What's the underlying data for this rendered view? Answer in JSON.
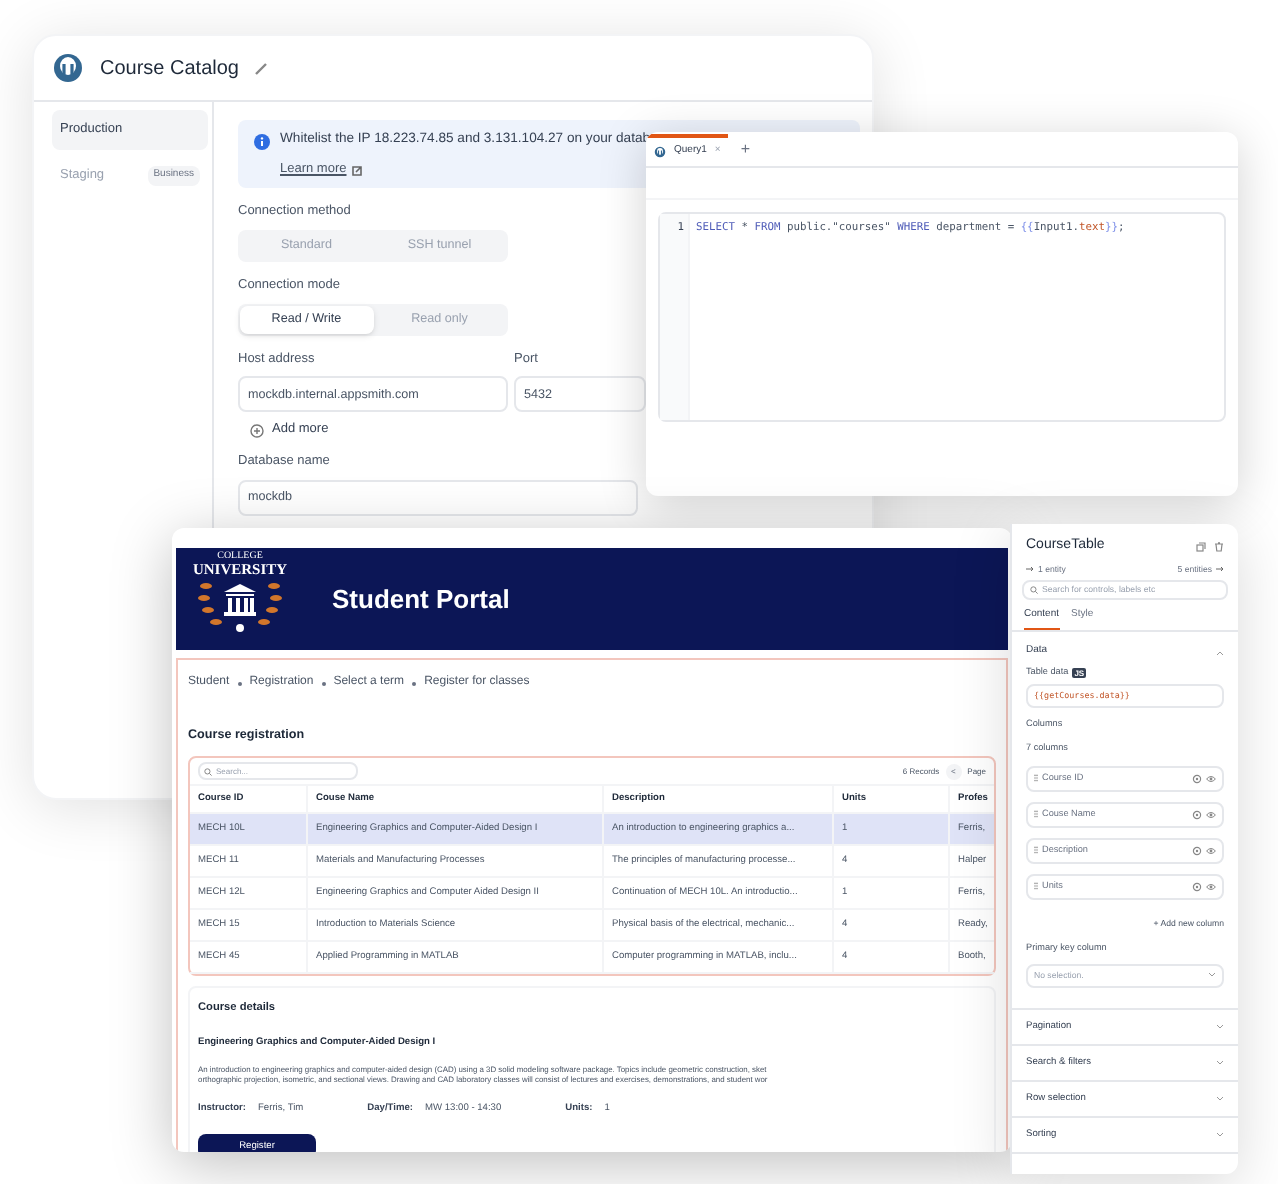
{
  "datasource": {
    "title": "Course Catalog",
    "environments": [
      {
        "label": "Production",
        "selected": true
      },
      {
        "label": "Staging",
        "selected": false,
        "badge": "Business"
      }
    ],
    "banner": {
      "text": "Whitelist the IP 18.223.74.85 and 3.131.104.27 on your datab",
      "link": "Learn more"
    },
    "connection_method": {
      "label": "Connection method",
      "options": [
        {
          "label": "Standard",
          "selected": false
        },
        {
          "label": "SSH tunnel",
          "selected": false
        }
      ]
    },
    "connection_mode": {
      "label": "Connection mode",
      "options": [
        {
          "label": "Read / Write",
          "selected": true
        },
        {
          "label": "Read only",
          "selected": false
        }
      ]
    },
    "host": {
      "label": "Host address",
      "value": "mockdb.internal.appsmith.com"
    },
    "port": {
      "label": "Port",
      "value": "5432"
    },
    "add_more": "Add more",
    "database": {
      "label": "Database name",
      "value": "mockdb"
    }
  },
  "query": {
    "tabs": [
      {
        "label": "Query1",
        "selected": true,
        "close": "×"
      }
    ],
    "add_tab": "+",
    "line_number": "1",
    "code": [
      {
        "text": "SELECT",
        "kind": "keyword"
      },
      {
        "text": " * ",
        "kind": "plain"
      },
      {
        "text": "FROM",
        "kind": "keyword"
      },
      {
        "text": " public.\"courses\" ",
        "kind": "plain"
      },
      {
        "text": "WHERE",
        "kind": "keyword"
      },
      {
        "text": " department = ",
        "kind": "plain"
      },
      {
        "text": "{{",
        "kind": "binding"
      },
      {
        "text": "Input1.",
        "kind": "plain"
      },
      {
        "text": "text",
        "kind": "property"
      },
      {
        "text": "}}",
        "kind": "binding"
      },
      {
        "text": ";",
        "kind": "plain"
      }
    ]
  },
  "portal": {
    "logo": {
      "top": "COLLEGE",
      "name": "UNIVERSITY"
    },
    "title": "Student Portal",
    "breadcrumbs": [
      "Student",
      "Registration",
      "Select a term",
      "Register for classes"
    ],
    "section_title": "Course registration",
    "table": {
      "search_placeholder": "Search...",
      "records": "6 Records",
      "prev": "<",
      "page": "Page",
      "columns": [
        "Course ID",
        "Couse Name",
        "Description",
        "Units",
        "Profes"
      ],
      "rows": [
        {
          "cells": [
            "MECH 10L",
            "Engineering Graphics and Computer-Aided Design I",
            "An introduction to engineering graphics a...",
            "1",
            "Ferris,"
          ],
          "selected": true
        },
        {
          "cells": [
            "MECH 11",
            "Materials and Manufacturing Processes",
            "The principles of manufacturing processe...",
            "4",
            "Halper"
          ],
          "selected": false
        },
        {
          "cells": [
            "MECH 12L",
            "Engineering Graphics and Computer Aided Design II",
            "Continuation of MECH 10L. An introductio...",
            "1",
            "Ferris,"
          ],
          "selected": false
        },
        {
          "cells": [
            "MECH 15",
            "Introduction to Materials Science",
            "Physical basis of the electrical, mechanic...",
            "4",
            "Ready,"
          ],
          "selected": false
        },
        {
          "cells": [
            "MECH 45",
            "Applied Programming in MATLAB",
            "Computer programming in MATLAB, inclu...",
            "4",
            "Booth,"
          ],
          "selected": false
        }
      ]
    },
    "details": {
      "heading": "Course details",
      "name": "Engineering Graphics and Computer-Aided Design I",
      "description": [
        "An introduction to engineering graphics and computer-aided design (CAD) using a 3D solid modeling software package. Topics include geometric construction, sket",
        "orthographic projection, isometric, and sectional views. Drawing and CAD laboratory classes will consist of lectures and exercises, demonstrations, and student wor"
      ],
      "fields": [
        {
          "label": "Instructor:",
          "value": "Ferris, Tim"
        },
        {
          "label": "Day/Time:",
          "value": "MW 13:00 - 14:30"
        },
        {
          "label": "Units:",
          "value": "1"
        }
      ],
      "button": "Register"
    }
  },
  "properties": {
    "title": "CourseTable",
    "back_link": "1 entity",
    "forward_link": "5 entities",
    "search_placeholder": "Search for controls, labels etc",
    "tabs": [
      {
        "label": "Content",
        "selected": true
      },
      {
        "label": "Style",
        "selected": false
      }
    ],
    "data_section": {
      "title": "Data",
      "expanded": true,
      "table_data_label": "Table data",
      "js_badge": "JS",
      "table_data_value": "{{getCourses.data}}",
      "columns_label": "Columns",
      "columns_count": "7 columns",
      "columns": [
        "Course ID",
        "Couse Name",
        "Description",
        "Units"
      ],
      "add_column": "+ Add new column",
      "primary_key_label": "Primary key column",
      "primary_key_placeholder": "No selection."
    },
    "sections": [
      {
        "title": "Pagination",
        "expanded": false
      },
      {
        "title": "Search & filters",
        "expanded": false
      },
      {
        "title": "Row selection",
        "expanded": false
      },
      {
        "title": "Sorting",
        "expanded": false
      }
    ]
  }
}
